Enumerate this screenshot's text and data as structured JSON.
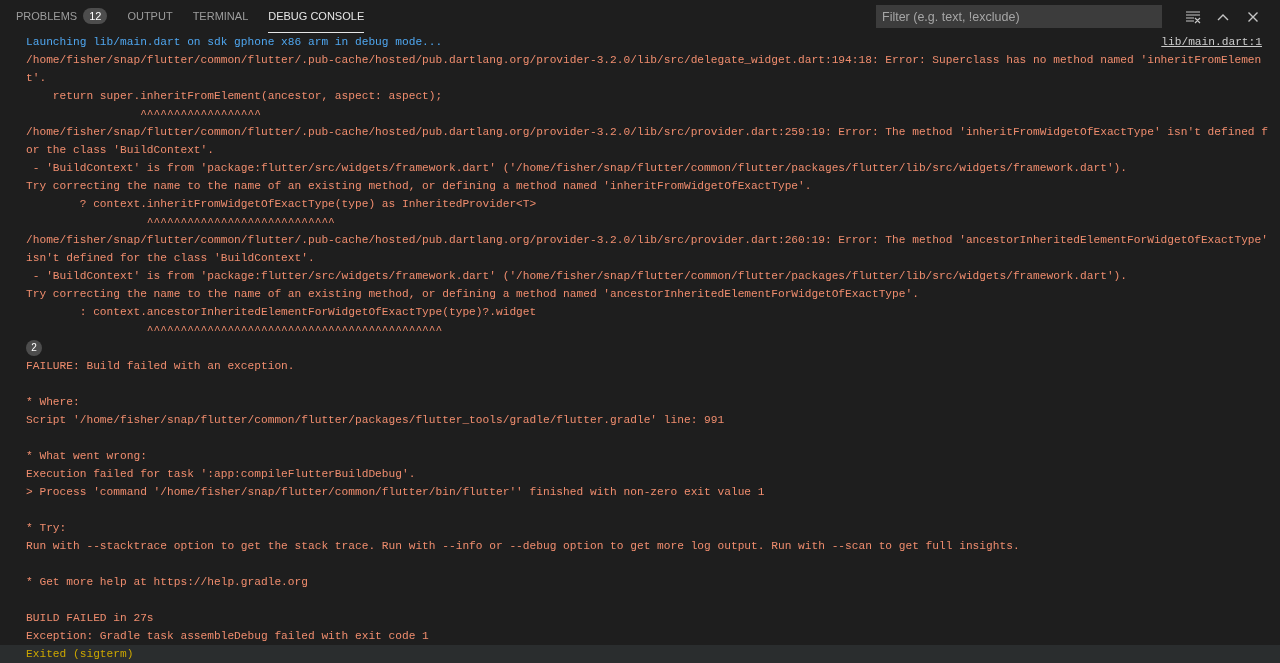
{
  "panel": {
    "tabs": [
      {
        "label": "PROBLEMS",
        "badge": "12",
        "selected": false
      },
      {
        "label": "OUTPUT",
        "selected": false
      },
      {
        "label": "TERMINAL",
        "selected": false
      },
      {
        "label": "DEBUG CONSOLE",
        "selected": true
      }
    ],
    "filter": {
      "placeholder": "Filter (e.g. text, !exclude)"
    }
  },
  "console": [
    {
      "kind": "info",
      "text": "Launching lib/main.dart on sdk gphone x86 arm in debug mode...",
      "source": "lib/main.dart:1"
    },
    {
      "kind": "error",
      "text": "/home/fisher/snap/flutter/common/flutter/.pub-cache/hosted/pub.dartlang.org/provider-3.2.0/lib/src/delegate_widget.dart:194:18: Error: Superclass has no method named 'inheritFromElemen"
    },
    {
      "kind": "error",
      "text": "t'."
    },
    {
      "kind": "error",
      "text": "    return super.inheritFromElement(ancestor, aspect: aspect);"
    },
    {
      "kind": "error",
      "text": "                 ^^^^^^^^^^^^^^^^^^"
    },
    {
      "kind": "error",
      "text": "/home/fisher/snap/flutter/common/flutter/.pub-cache/hosted/pub.dartlang.org/provider-3.2.0/lib/src/provider.dart:259:19: Error: The method 'inheritFromWidgetOfExactType' isn't defined f"
    },
    {
      "kind": "error",
      "text": "or the class 'BuildContext'."
    },
    {
      "kind": "error",
      "text": " - 'BuildContext' is from 'package:flutter/src/widgets/framework.dart' ('/home/fisher/snap/flutter/common/flutter/packages/flutter/lib/src/widgets/framework.dart')."
    },
    {
      "kind": "error",
      "text": "Try correcting the name to the name of an existing method, or defining a method named 'inheritFromWidgetOfExactType'."
    },
    {
      "kind": "error",
      "text": "        ? context.inheritFromWidgetOfExactType(type) as InheritedProvider<T>"
    },
    {
      "kind": "error",
      "text": "                  ^^^^^^^^^^^^^^^^^^^^^^^^^^^^"
    },
    {
      "kind": "error",
      "text": "/home/fisher/snap/flutter/common/flutter/.pub-cache/hosted/pub.dartlang.org/provider-3.2.0/lib/src/provider.dart:260:19: Error: The method 'ancestorInheritedElementForWidgetOfExactType'"
    },
    {
      "kind": "error",
      "text": "isn't defined for the class 'BuildContext'."
    },
    {
      "kind": "error",
      "text": " - 'BuildContext' is from 'package:flutter/src/widgets/framework.dart' ('/home/fisher/snap/flutter/common/flutter/packages/flutter/lib/src/widgets/framework.dart')."
    },
    {
      "kind": "error",
      "text": "Try correcting the name to the name of an existing method, or defining a method named 'ancestorInheritedElementForWidgetOfExactType'."
    },
    {
      "kind": "error",
      "text": "        : context.ancestorInheritedElementForWidgetOfExactType(type)?.widget"
    },
    {
      "kind": "error",
      "text": "                  ^^^^^^^^^^^^^^^^^^^^^^^^^^^^^^^^^^^^^^^^^^^^"
    },
    {
      "kind": "count",
      "text": "2"
    },
    {
      "kind": "error",
      "text": "FAILURE: Build failed with an exception."
    },
    {
      "kind": "blank"
    },
    {
      "kind": "error",
      "text": "* Where:"
    },
    {
      "kind": "error",
      "text": "Script '/home/fisher/snap/flutter/common/flutter/packages/flutter_tools/gradle/flutter.gradle' line: 991"
    },
    {
      "kind": "blank"
    },
    {
      "kind": "error",
      "text": "* What went wrong:"
    },
    {
      "kind": "error",
      "text": "Execution failed for task ':app:compileFlutterBuildDebug'."
    },
    {
      "kind": "error",
      "text": "> Process 'command '/home/fisher/snap/flutter/common/flutter/bin/flutter'' finished with non-zero exit value 1"
    },
    {
      "kind": "blank"
    },
    {
      "kind": "error",
      "text": "* Try:"
    },
    {
      "kind": "error",
      "text": "Run with --stacktrace option to get the stack trace. Run with --info or --debug option to get more log output. Run with --scan to get full insights."
    },
    {
      "kind": "blank"
    },
    {
      "kind": "error",
      "text": "* Get more help at https://help.gradle.org"
    },
    {
      "kind": "blank"
    },
    {
      "kind": "error",
      "text": "BUILD FAILED in 27s"
    },
    {
      "kind": "error",
      "text": "Exception: Gradle task assembleDebug failed with exit code 1"
    },
    {
      "kind": "status",
      "text": "Exited (sigterm)"
    }
  ]
}
